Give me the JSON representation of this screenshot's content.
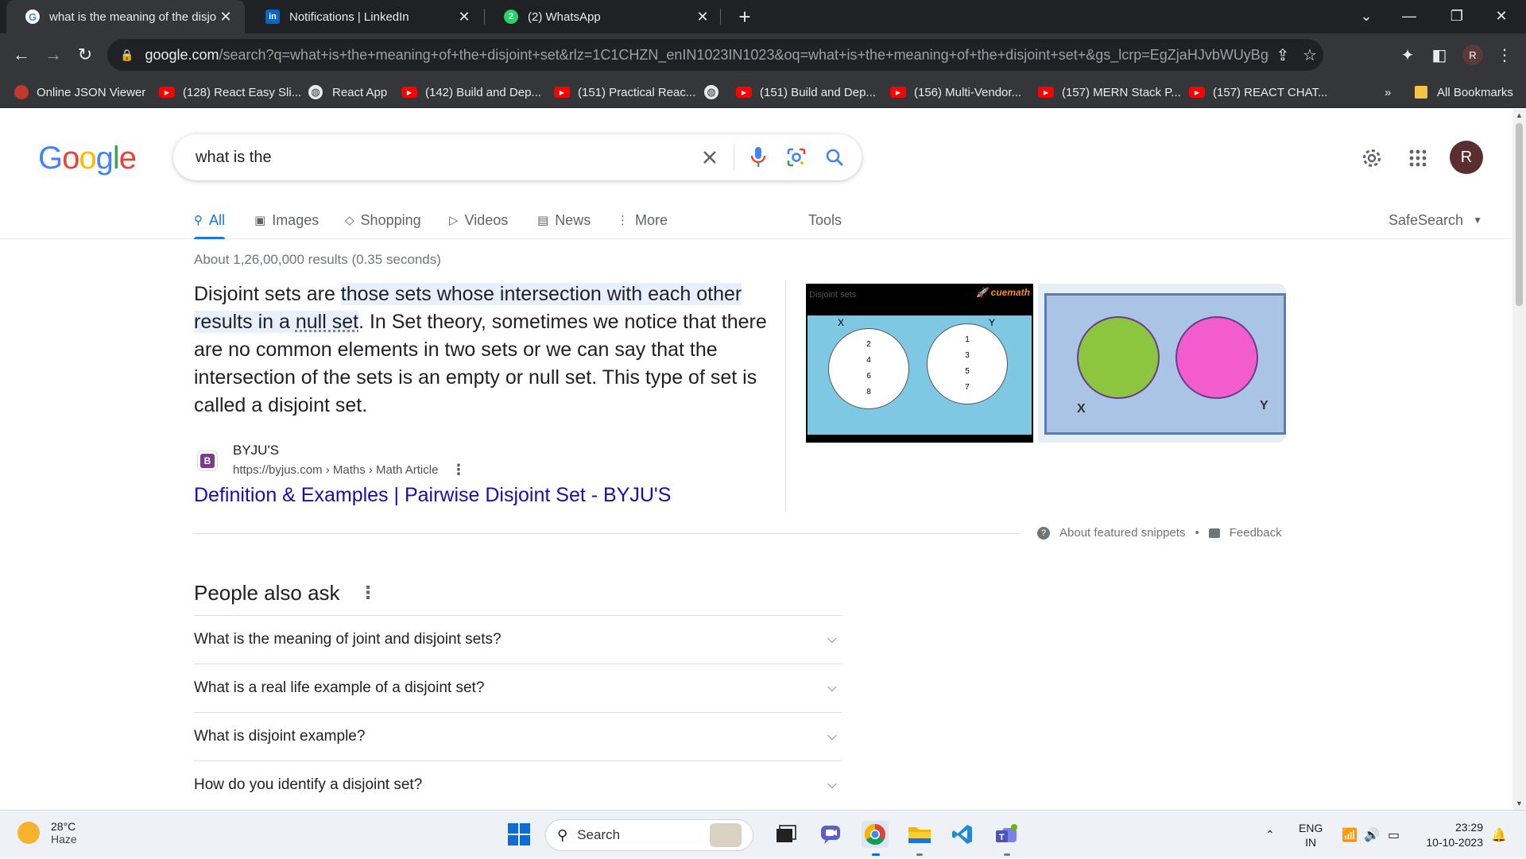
{
  "browser": {
    "tabs": [
      {
        "title": "what is the meaning of the disjo",
        "active": true,
        "favicon": "google-icon"
      },
      {
        "title": "Notifications | LinkedIn",
        "active": false,
        "favicon": "linkedin-icon",
        "favicon_text": "in"
      },
      {
        "title": "(2) WhatsApp",
        "active": false,
        "favicon": "whatsapp-icon",
        "favicon_text": "2"
      }
    ],
    "url_host": "google.com",
    "url_rest": "/search?q=what+is+the+meaning+of+the+disjoint+set&rlz=1C1CHZN_enIN1023IN1023&oq=what+is+the+meaning+of+the+disjoint+set+&gs_lcrp=EgZjaHJvbWUyBggAEEUY...",
    "profile_initial": "R",
    "bookmarks": [
      {
        "label": "Online JSON Viewer",
        "icon": "json-viewer-icon"
      },
      {
        "label": "(128) React Easy Sli...",
        "icon": "youtube-icon"
      },
      {
        "label": "React App",
        "icon": "globe-icon"
      },
      {
        "label": "(142) Build and Dep...",
        "icon": "youtube-icon"
      },
      {
        "label": "(151) Practical Reac...",
        "icon": "youtube-icon"
      },
      {
        "label": "",
        "icon": "globe-icon"
      },
      {
        "label": "(151) Build and Dep...",
        "icon": "youtube-icon"
      },
      {
        "label": "(156) Multi-Vendor...",
        "icon": "youtube-icon"
      },
      {
        "label": "(157) MERN Stack P...",
        "icon": "youtube-icon"
      },
      {
        "label": "(157) REACT CHAT...",
        "icon": "youtube-icon"
      }
    ],
    "bookmarks_overflow": "»",
    "all_bookmarks": "All Bookmarks"
  },
  "google": {
    "logo": [
      "G",
      "o",
      "o",
      "g",
      "l",
      "e"
    ],
    "logo_colors": [
      "#4285F4",
      "#EA4335",
      "#FBBC05",
      "#4285F4",
      "#34A853",
      "#EA4335"
    ],
    "query": "what is the",
    "avatar_initial": "R",
    "tabs": [
      {
        "label": "All",
        "icon": "search-icon",
        "active": true
      },
      {
        "label": "Images",
        "icon": "image-icon"
      },
      {
        "label": "Shopping",
        "icon": "tag-icon"
      },
      {
        "label": "Videos",
        "icon": "play-icon"
      },
      {
        "label": "News",
        "icon": "news-icon"
      },
      {
        "label": "More",
        "icon": "more-vert-icon"
      }
    ],
    "tools": "Tools",
    "safesearch": "SafeSearch",
    "stats": "About 1,26,00,000 results (0.35 seconds)",
    "snippet": {
      "pre": "Disjoint sets are ",
      "highlight_a": "those sets whose intersection with each other results in a ",
      "highlight_b": "null set",
      "post": ". In Set theory, sometimes we notice that there are no common elements in two sets or we can say that the intersection of the sets is an empty or null set. This type of set is called a disjoint set."
    },
    "thumb1": {
      "caption": "Disjoint sets",
      "brand": "cuemath",
      "set_x_label": "X",
      "set_y_label": "Y",
      "set_x": [
        "2",
        "4",
        "6",
        "8"
      ],
      "set_y": [
        "1",
        "3",
        "5",
        "7"
      ]
    },
    "thumb2": {
      "set_x_label": "X",
      "set_y_label": "Y",
      "color_x": "#8cc63f",
      "color_y": "#f25ccd"
    },
    "source": {
      "name": "BYJU'S",
      "url": "https://byjus.com › Maths › Math Article",
      "icon_letter": "B"
    },
    "result_title": "Definition & Examples | Pairwise Disjoint Set - BYJU'S",
    "about_snippets": "About featured snippets",
    "separator": "•",
    "feedback": "Feedback",
    "paa_title": "People also ask",
    "paa": [
      "What is the meaning of joint and disjoint sets?",
      "What is a real life example of a disjoint set?",
      "What is disjoint example?",
      "How do you identify a disjoint set?"
    ]
  },
  "taskbar": {
    "temperature": "28°C",
    "weather": "Haze",
    "search_label": "Search",
    "lang_top": "ENG",
    "lang_bottom": "IN",
    "time": "23:29",
    "date": "10-10-2023"
  },
  "colors": {
    "link": "#1a0dab",
    "accent": "#1a73e8",
    "chrome_dark": "#202124",
    "chrome_toolbar": "#35363a"
  }
}
